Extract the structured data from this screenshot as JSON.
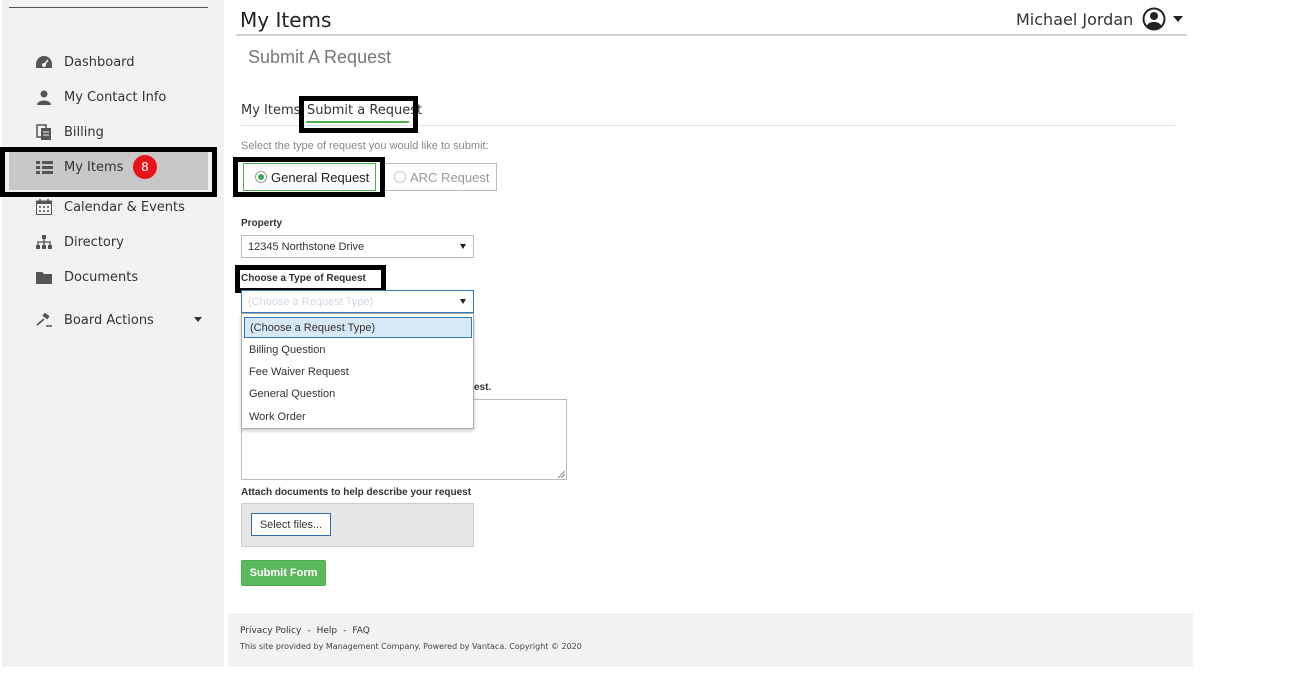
{
  "header": {
    "title": "My Items",
    "user_name": "Michael Jordan"
  },
  "sidebar": {
    "items": [
      {
        "label": "Dashboard",
        "icon": "dashboard-icon"
      },
      {
        "label": "My Contact Info",
        "icon": "user-icon"
      },
      {
        "label": "Billing",
        "icon": "billing-icon"
      },
      {
        "label": "My Items",
        "icon": "list-icon",
        "badge": "8",
        "selected": true
      },
      {
        "label": "Calendar & Events",
        "icon": "calendar-icon"
      },
      {
        "label": "Directory",
        "icon": "org-chart-icon"
      },
      {
        "label": "Documents",
        "icon": "folder-icon"
      },
      {
        "label": "Board Actions",
        "icon": "gavel-icon"
      }
    ]
  },
  "main": {
    "subtitle": "Submit A Request",
    "tabs": [
      {
        "label": "My Items"
      },
      {
        "label": "Submit a Request",
        "active": true
      }
    ],
    "prompt": "Select the type of request you would like to submit:",
    "request_types": [
      {
        "label": "General Request",
        "selected": true
      },
      {
        "label": "ARC Request",
        "selected": false
      }
    ],
    "property": {
      "label": "Property",
      "value": "12345 Northstone Drive"
    },
    "request_type": {
      "label": "Choose a Type of Request",
      "value": "(Choose a Request Type)",
      "options": [
        "(Choose a Request Type)",
        "Billing Question",
        "Fee Waiver Request",
        "General Question",
        "Work Order"
      ]
    },
    "partial_label": "est.",
    "attach": {
      "label": "Attach documents to help describe your request",
      "button": "Select files..."
    },
    "submit_label": "Submit Form"
  },
  "footer": {
    "links": [
      "Privacy Policy",
      "-",
      "Help",
      "-",
      "FAQ"
    ],
    "copyright": "This site provided by Management Company. Powered by Vantaca. Copyright © 2020"
  },
  "colors": {
    "accent_green": "#5cb85c",
    "badge_red": "#e8141c",
    "sidebar_bg": "#f2f3f0"
  }
}
